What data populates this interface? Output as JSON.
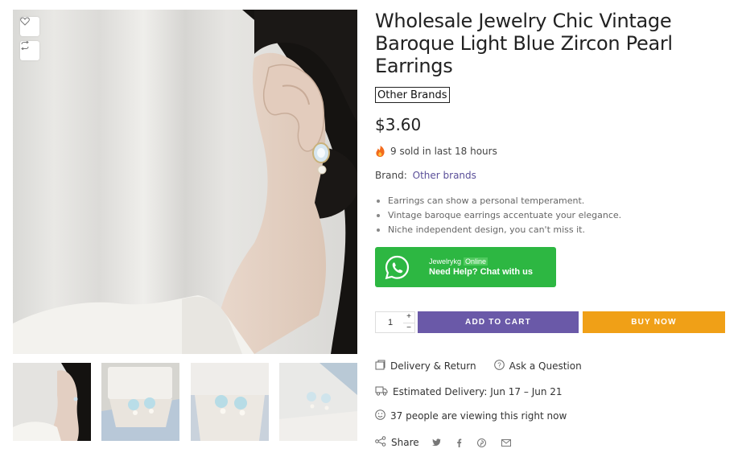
{
  "product": {
    "title": "Wholesale Jewelry Chic Vintage Baroque Light Blue Zircon Pearl Earrings",
    "brand_tag": "Other Brands",
    "price": "$3.60",
    "sold_text": "9 sold in last 18 hours",
    "brand_label": "Brand:",
    "brand_value": "Other brands",
    "features": [
      "Earrings can show a personal temperament.",
      "Vintage baroque earrings accentuate your elegance.",
      "Niche independent design, you can't miss it."
    ]
  },
  "gallery": {
    "wishlist_icon": "heart-icon",
    "compare_icon": "compare-arrows-icon",
    "thumbnail_count": 4
  },
  "whatsapp": {
    "name": "Jewelrykg",
    "status": "Online",
    "cta": "Need Help? Chat with us",
    "color": "#2db742"
  },
  "cart": {
    "quantity": "1",
    "plus": "+",
    "minus": "−",
    "add_to_cart": "ADD TO CART",
    "buy_now": "BUY NOW",
    "add_color": "#6a59a8",
    "buy_color": "#f0a017"
  },
  "meta": {
    "delivery_return": "Delivery & Return",
    "ask_question": "Ask a Question",
    "estimated_delivery": "Estimated Delivery: Jun 17 – Jun 21",
    "viewing": "37 people are viewing this right now",
    "share": "Share",
    "share_icons": [
      "twitter-icon",
      "facebook-icon",
      "pinterest-icon",
      "email-icon"
    ]
  }
}
